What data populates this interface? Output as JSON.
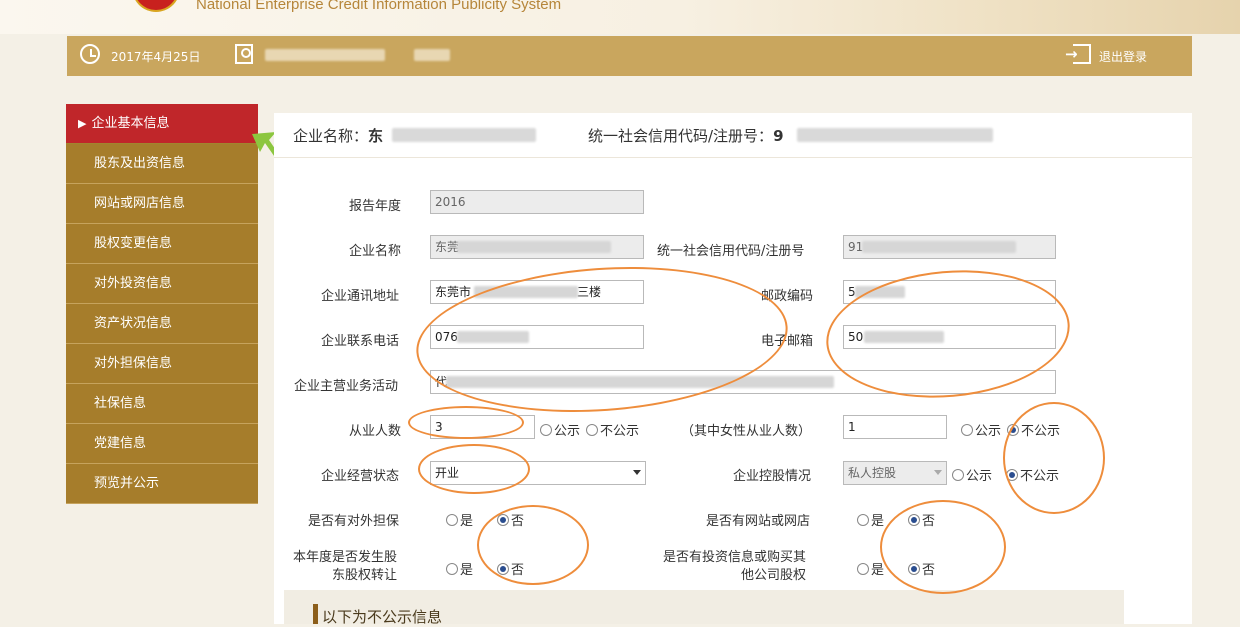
{
  "header": {
    "system_name": "National Enterprise Credit Information Publicity System"
  },
  "navbar": {
    "date": "2017年4月25日",
    "logout_label": "退出登录"
  },
  "sidebar": {
    "items": [
      {
        "label": "企业基本信息",
        "active": true
      },
      {
        "label": "股东及出资信息",
        "active": false
      },
      {
        "label": "网站或网店信息",
        "active": false
      },
      {
        "label": "股权变更信息",
        "active": false
      },
      {
        "label": "对外投资信息",
        "active": false
      },
      {
        "label": "资产状况信息",
        "active": false
      },
      {
        "label": "对外担保信息",
        "active": false
      },
      {
        "label": "社保信息",
        "active": false
      },
      {
        "label": "党建信息",
        "active": false
      },
      {
        "label": "预览并公示",
        "active": false
      }
    ]
  },
  "company_header": {
    "name_label": "企业名称：",
    "name_value": "东",
    "code_label": "统一社会信用代码/注册号：",
    "code_value": "9"
  },
  "form": {
    "report_year": {
      "label": "报告年度",
      "value": "2016"
    },
    "company_name": {
      "label": "企业名称",
      "value": "东莞"
    },
    "credit_code": {
      "label": "统一社会信用代码/注册号",
      "value": "91"
    },
    "address": {
      "label": "企业通讯地址",
      "value_prefix": "东莞市",
      "value_suffix": "三楼"
    },
    "postcode": {
      "label": "邮政编码",
      "value": "5"
    },
    "phone": {
      "label": "企业联系电话",
      "value": "076"
    },
    "email": {
      "label": "电子邮箱",
      "value_prefix": "50",
      "value_suffix": "m"
    },
    "business": {
      "label": "企业主营业务活动",
      "value": "代"
    },
    "employees": {
      "label": "从业人数",
      "value": "3",
      "public_label": "公示",
      "private_label": "不公示",
      "selected": "none"
    },
    "female_employees": {
      "label": "（其中女性从业人数）",
      "value": "1",
      "public_label": "公示",
      "private_label": "不公示",
      "selected": "private"
    },
    "status": {
      "label": "企业经营状态",
      "value": "开业"
    },
    "holding": {
      "label": "企业控股情况",
      "value": "私人控股",
      "public_label": "公示",
      "private_label": "不公示",
      "selected": "private"
    },
    "guarantee": {
      "label": "是否有对外担保",
      "yes_label": "是",
      "no_label": "否",
      "selected": "no"
    },
    "website": {
      "label": "是否有网站或网店",
      "yes_label": "是",
      "no_label": "否",
      "selected": "no"
    },
    "equity_transfer": {
      "label_line1": "本年度是否发生股",
      "label_line2": "东股权转让",
      "yes_label": "是",
      "no_label": "否",
      "selected": "no"
    },
    "investment": {
      "label_line1": "是否有投资信息或购买其",
      "label_line2": "他公司股权",
      "yes_label": "是",
      "no_label": "否",
      "selected": "no"
    }
  },
  "hidden_section": {
    "title": "以下为不公示信息"
  },
  "colors": {
    "active_menu": "#c0262a",
    "menu": "#a67d2b",
    "navbar": "#c9a65e",
    "annotation": "#ee8d3c",
    "pointer_arrow": "#8cc63f"
  }
}
